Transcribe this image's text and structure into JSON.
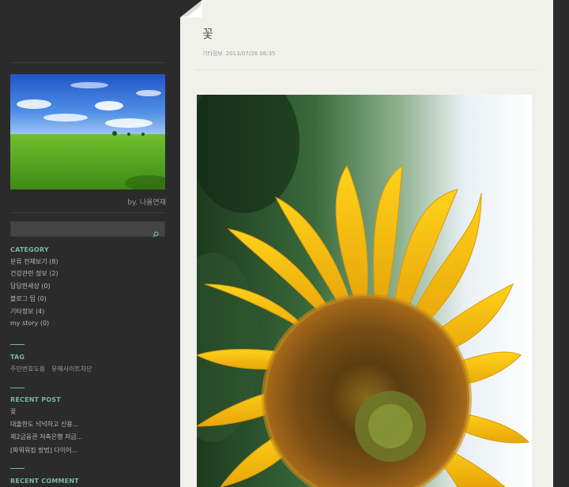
{
  "sidebar": {
    "byline": "by. 나올연재",
    "search": {
      "placeholder": ""
    },
    "category": {
      "title": "CATEGORY",
      "items": [
        "분류 전체보기 (8)",
        "건강관련 정보 (2)",
        "답답한세상 (0)",
        "블로그 팁 (0)",
        "기타정보 (4)",
        "my story (0)"
      ]
    },
    "tag": {
      "title": "TAG",
      "items": [
        "주민번호도용",
        "유해사이트차단"
      ]
    },
    "recent_post": {
      "title": "RECENT POST",
      "items": [
        "꽃",
        "대출한도 넉넉하고 신용...",
        "제2금융권 저축은행 저금...",
        "[파워워킹 방법] 다이어..."
      ]
    },
    "recent_comment": {
      "title": "RECENT COMMENT"
    }
  },
  "post": {
    "title": "꽃",
    "category": "기타정보",
    "datetime": "2013/07/28 08:35"
  },
  "colors": {
    "sidebar_bg": "#2b2b2b",
    "accent": "#7ab6a6",
    "content_bg": "#f1f1ec"
  },
  "icons": {
    "search": "search-icon",
    "page_fold": "page-fold-icon"
  }
}
